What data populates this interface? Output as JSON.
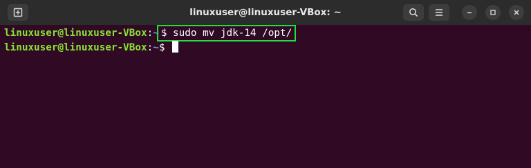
{
  "window": {
    "title": "linuxuser@linuxuser-VBox: ~"
  },
  "icons": {
    "new_tab": "new-tab-icon",
    "search": "search-icon",
    "menu": "hamburger-menu-icon",
    "minimize": "minimize-icon",
    "maximize": "maximize-icon",
    "close": "close-icon"
  },
  "terminal": {
    "lines": [
      {
        "user_host": "linuxuser@linuxuser-VBox",
        "separator": ":",
        "path": "~",
        "command": "$ sudo mv jdk-14 /opt/"
      },
      {
        "user_host": "linuxuser@linuxuser-VBox",
        "separator": ":",
        "path": "~",
        "command": "$ "
      }
    ]
  },
  "colors": {
    "terminal_bg": "#300a24",
    "titlebar_bg": "#2c2c2c",
    "prompt_user": "#8ae234",
    "prompt_path": "#729fcf",
    "highlight_border": "#22e03a"
  }
}
